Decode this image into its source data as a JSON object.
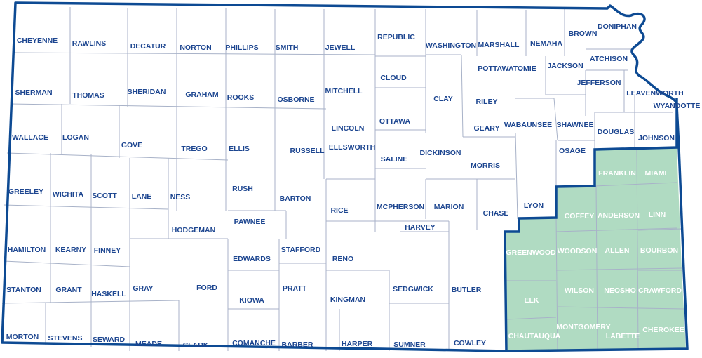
{
  "colors": {
    "border": "#0d4a93",
    "label": "#1d4690",
    "highlight_fill": "#b0dbc2",
    "highlight_label": "#ffffff",
    "county_line": "#a8b2c8"
  },
  "counties": [
    {
      "name": "CHEYENNE"
    },
    {
      "name": "RAWLINS"
    },
    {
      "name": "DECATUR"
    },
    {
      "name": "NORTON"
    },
    {
      "name": "PHILLIPS"
    },
    {
      "name": "SMITH"
    },
    {
      "name": "JEWELL"
    },
    {
      "name": "REPUBLIC"
    },
    {
      "name": "WASHINGTON"
    },
    {
      "name": "MARSHALL"
    },
    {
      "name": "NEMAHA"
    },
    {
      "name": "BROWN"
    },
    {
      "name": "DONIPHAN"
    },
    {
      "name": "SHERMAN"
    },
    {
      "name": "THOMAS"
    },
    {
      "name": "SHERIDAN"
    },
    {
      "name": "GRAHAM"
    },
    {
      "name": "ROOKS"
    },
    {
      "name": "OSBORNE"
    },
    {
      "name": "MITCHELL"
    },
    {
      "name": "CLOUD"
    },
    {
      "name": "CLAY"
    },
    {
      "name": "POTTAWATOMIE"
    },
    {
      "name": "JACKSON"
    },
    {
      "name": "ATCHISON"
    },
    {
      "name": "JEFFERSON"
    },
    {
      "name": "LEAVENWORTH"
    },
    {
      "name": "WYANDOTTE"
    },
    {
      "name": "RILEY"
    },
    {
      "name": "GEARY"
    },
    {
      "name": "WABAUNSEE"
    },
    {
      "name": "SHAWNEE"
    },
    {
      "name": "DOUGLAS"
    },
    {
      "name": "JOHNSON"
    },
    {
      "name": "WALLACE"
    },
    {
      "name": "LOGAN"
    },
    {
      "name": "GOVE"
    },
    {
      "name": "TREGO"
    },
    {
      "name": "ELLIS"
    },
    {
      "name": "RUSSELL"
    },
    {
      "name": "LINCOLN"
    },
    {
      "name": "ELLSWORTH"
    },
    {
      "name": "OTTAWA"
    },
    {
      "name": "SALINE"
    },
    {
      "name": "DICKINSON"
    },
    {
      "name": "MORRIS"
    },
    {
      "name": "OSAGE"
    },
    {
      "name": "FRANKLIN",
      "highlighted": true
    },
    {
      "name": "MIAMI",
      "highlighted": true
    },
    {
      "name": "GREELEY"
    },
    {
      "name": "WICHITA"
    },
    {
      "name": "SCOTT"
    },
    {
      "name": "LANE"
    },
    {
      "name": "NESS"
    },
    {
      "name": "RUSH"
    },
    {
      "name": "BARTON"
    },
    {
      "name": "RICE"
    },
    {
      "name": "MCPHERSON"
    },
    {
      "name": "MARION"
    },
    {
      "name": "CHASE"
    },
    {
      "name": "LYON"
    },
    {
      "name": "COFFEY",
      "highlighted": true
    },
    {
      "name": "ANDERSON",
      "highlighted": true
    },
    {
      "name": "LINN",
      "highlighted": true
    },
    {
      "name": "HAMILTON"
    },
    {
      "name": "KEARNY"
    },
    {
      "name": "FINNEY"
    },
    {
      "name": "HODGEMAN"
    },
    {
      "name": "PAWNEE"
    },
    {
      "name": "EDWARDS"
    },
    {
      "name": "STAFFORD"
    },
    {
      "name": "RENO"
    },
    {
      "name": "HARVEY"
    },
    {
      "name": "GREENWOOD",
      "highlighted": true
    },
    {
      "name": "WOODSON",
      "highlighted": true
    },
    {
      "name": "ALLEN",
      "highlighted": true
    },
    {
      "name": "BOURBON",
      "highlighted": true
    },
    {
      "name": "STANTON"
    },
    {
      "name": "GRANT"
    },
    {
      "name": "HASKELL"
    },
    {
      "name": "GRAY"
    },
    {
      "name": "FORD"
    },
    {
      "name": "KIOWA"
    },
    {
      "name": "PRATT"
    },
    {
      "name": "KINGMAN"
    },
    {
      "name": "SEDGWICK"
    },
    {
      "name": "BUTLER"
    },
    {
      "name": "ELK",
      "highlighted": true
    },
    {
      "name": "WILSON",
      "highlighted": true
    },
    {
      "name": "NEOSHO",
      "highlighted": true
    },
    {
      "name": "CRAWFORD",
      "highlighted": true
    },
    {
      "name": "MORTON"
    },
    {
      "name": "STEVENS"
    },
    {
      "name": "SEWARD"
    },
    {
      "name": "MEADE"
    },
    {
      "name": "CLARK"
    },
    {
      "name": "COMANCHE"
    },
    {
      "name": "BARBER"
    },
    {
      "name": "HARPER"
    },
    {
      "name": "SUMNER"
    },
    {
      "name": "COWLEY"
    },
    {
      "name": "CHAUTAUQUA",
      "highlighted": true
    },
    {
      "name": "MONTGOMERY",
      "highlighted": true
    },
    {
      "name": "LABETTE",
      "highlighted": true
    },
    {
      "name": "CHEROKEE",
      "highlighted": true
    }
  ]
}
